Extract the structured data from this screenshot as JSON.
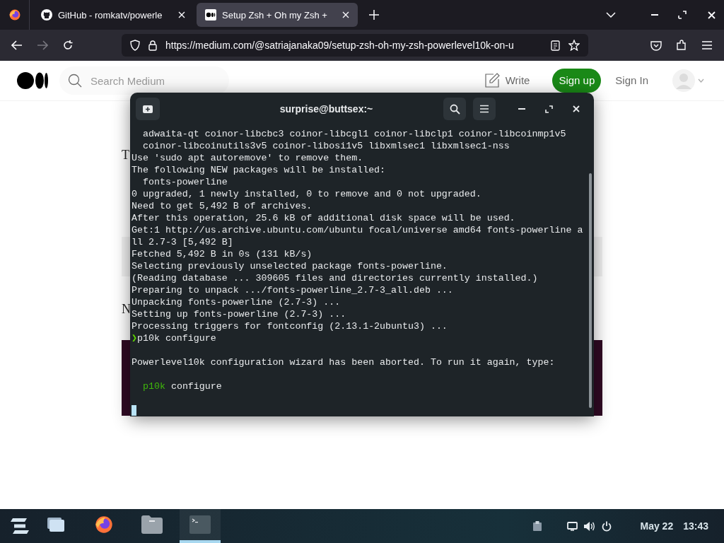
{
  "browser": {
    "tabs": [
      {
        "label": "GitHub - romkatv/powerle",
        "kind": "github",
        "selected": false
      },
      {
        "label": "Setup Zsh + Oh my Zsh +",
        "kind": "medium",
        "selected": true
      }
    ],
    "url": "https://medium.com/@satriajanaka09/setup-zsh-oh-my-zsh-powerlevel10k-on-u"
  },
  "site": {
    "search": {
      "placeholder": "Search Medium"
    },
    "write": "Write",
    "sign_up": "Sign up",
    "sign_in": "Sign In"
  },
  "article": {
    "fragments": [
      "T",
      "N"
    ]
  },
  "terminal": {
    "title": "surprise@buttsex:~",
    "lines": [
      {
        "kind": "text",
        "text": "  adwaita-qt coinor-libcbc3 coinor-libcgl1 coinor-libclp1 coinor-libcoinmp1v5"
      },
      {
        "kind": "text",
        "text": "  coinor-libcoinutils3v5 coinor-libosi1v5 libxmlsec1 libxmlsec1-nss"
      },
      {
        "kind": "text",
        "text": "Use 'sudo apt autoremove' to remove them."
      },
      {
        "kind": "text",
        "text": "The following NEW packages will be installed:"
      },
      {
        "kind": "text",
        "text": "  fonts-powerline"
      },
      {
        "kind": "text",
        "text": "0 upgraded, 1 newly installed, 0 to remove and 0 not upgraded."
      },
      {
        "kind": "text",
        "text": "Need to get 5,492 B of archives."
      },
      {
        "kind": "text",
        "text": "After this operation, 25.6 kB of additional disk space will be used."
      },
      {
        "kind": "text",
        "text": "Get:1 http://us.archive.ubuntu.com/ubuntu focal/universe amd64 fonts-powerline a"
      },
      {
        "kind": "text",
        "text": "ll 2.7-3 [5,492 B]"
      },
      {
        "kind": "text",
        "text": "Fetched 5,492 B in 0s (131 kB/s)"
      },
      {
        "kind": "text",
        "text": "Selecting previously unselected package fonts-powerline."
      },
      {
        "kind": "text",
        "text": "(Reading database ... 309605 files and directories currently installed.)"
      },
      {
        "kind": "text",
        "text": "Preparing to unpack .../fonts-powerline_2.7-3_all.deb ..."
      },
      {
        "kind": "text",
        "text": "Unpacking fonts-powerline (2.7-3) ..."
      },
      {
        "kind": "text",
        "text": "Setting up fonts-powerline (2.7-3) ..."
      },
      {
        "kind": "text",
        "text": "Processing triggers for fontconfig (2.13.1-2ubuntu3) ..."
      },
      {
        "kind": "prompt",
        "symbol": "❯",
        "text": "p10k configure"
      },
      {
        "kind": "blank"
      },
      {
        "kind": "text",
        "text": "Powerlevel10k configuration wizard has been aborted. To run it again, type:"
      },
      {
        "kind": "blank"
      },
      {
        "kind": "command",
        "command": "p10k",
        "text": "configure"
      },
      {
        "kind": "blank"
      },
      {
        "kind": "cursor"
      }
    ]
  },
  "taskbar": {
    "apps": [
      {
        "kind": "windows",
        "selected": false
      },
      {
        "kind": "firefox",
        "selected": false
      },
      {
        "kind": "files",
        "selected": false
      },
      {
        "kind": "terminal",
        "selected": true
      }
    ],
    "date": "May 22",
    "time": "13:43"
  }
}
